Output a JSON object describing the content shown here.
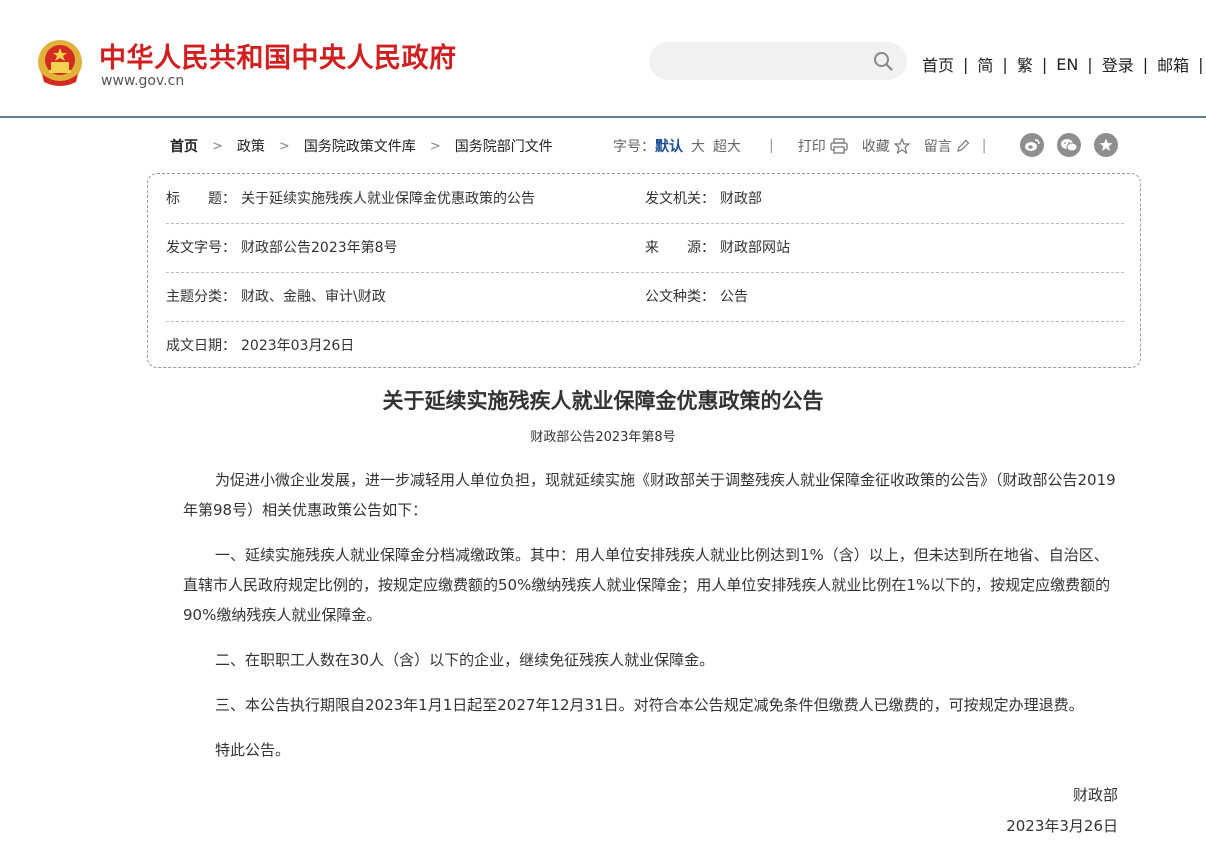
{
  "header": {
    "site_title": "中华人民共和国中央人民政府",
    "site_url": "www.gov.cn",
    "search_placeholder": "",
    "nav": [
      "首页",
      "简",
      "繁",
      "EN",
      "登录",
      "邮箱"
    ],
    "nav_sep": "|"
  },
  "breadcrumb": {
    "items": [
      "首页",
      "政策",
      "国务院政策文件库",
      "国务院部门文件"
    ],
    "arrow": ">"
  },
  "toolbar": {
    "font_label": "字号：",
    "font_options": [
      "默认",
      "大",
      "超大"
    ],
    "separator": "|",
    "print": "打印",
    "favorite": "收藏",
    "comment": "留言"
  },
  "share": {
    "icons": [
      "weibo-icon",
      "wechat-icon",
      "qzone-icon"
    ]
  },
  "info": {
    "title_label": "标　　题：",
    "title_value": "关于延续实施残疾人就业保障金优惠政策的公告",
    "issuer_label": "发文机关：",
    "issuer_value": "财政部",
    "doc_no_label": "发文字号：",
    "doc_no_value": "财政部公告2023年第8号",
    "source_label": "来　　源：",
    "source_value": "财政部网站",
    "topic_label": "主题分类：",
    "topic_value": "财政、金融、审计\\财政",
    "type_label": "公文种类：",
    "type_value": "公告",
    "date_label": "成文日期：",
    "date_value": "2023年03月26日"
  },
  "article": {
    "title": "关于延续实施残疾人就业保障金优惠政策的公告",
    "subtitle": "财政部公告2023年第8号",
    "paragraphs": [
      "为促进小微企业发展，进一步减轻用人单位负担，现就延续实施《财政部关于调整残疾人就业保障金征收政策的公告》（财政部公告2019年第98号）相关优惠政策公告如下：",
      "一、延续实施残疾人就业保障金分档减缴政策。其中：用人单位安排残疾人就业比例达到1%（含）以上，但未达到所在地省、自治区、直辖市人民政府规定比例的，按规定应缴费额的50%缴纳残疾人就业保障金；用人单位安排残疾人就业比例在1%以下的，按规定应缴费额的90%缴纳残疾人就业保障金。",
      "二、在职职工人数在30人（含）以下的企业，继续免征残疾人就业保障金。",
      "三、本公告执行期限自2023年1月1日起至2027年12月31日。对符合本公告规定减免条件但缴费人已缴费的，可按规定办理退费。",
      "特此公告。"
    ],
    "signature": "财政部",
    "sign_date": "2023年3月26日"
  },
  "colors": {
    "brand_red": "#d01f1f",
    "header_line": "#5c7f8e",
    "active_blue": "#1c4f94"
  }
}
